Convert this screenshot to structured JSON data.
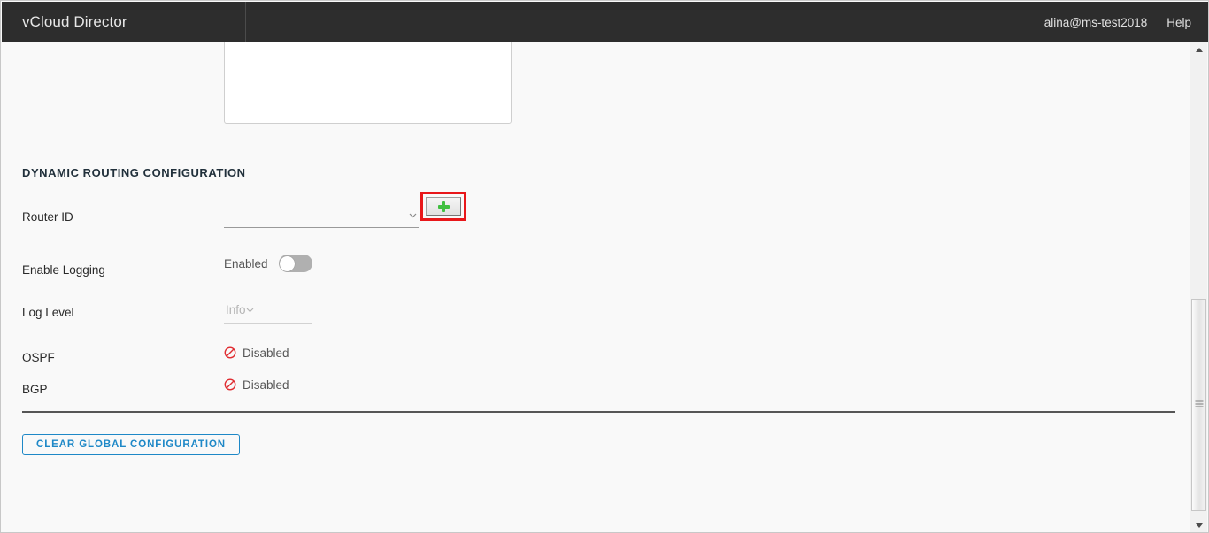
{
  "header": {
    "brand": "vCloud Director",
    "user": "alina@ms-test2018",
    "help": "Help"
  },
  "main": {
    "section_title": "DYNAMIC ROUTING CONFIGURATION",
    "rows": {
      "router_id": {
        "label": "Router ID",
        "value": "",
        "placeholder": "",
        "add_button_tooltip": "+"
      },
      "enable_logging": {
        "label": "Enable Logging",
        "state_text": "Enabled",
        "toggled": "false"
      },
      "log_level": {
        "label": "Log Level",
        "value": "Info",
        "disabled": "true"
      },
      "ospf": {
        "label": "OSPF",
        "status": "Disabled"
      },
      "bgp": {
        "label": "BGP",
        "status": "Disabled"
      }
    },
    "clear_button_label": "CLEAR GLOBAL CONFIGURATION"
  },
  "colors": {
    "header_bg": "#2d2d2d",
    "page_bg": "#f9f9f9",
    "accent_link": "#1e88c7",
    "highlight_red": "#e8171a",
    "status_red": "#e02b30",
    "plus_green": "#3fbf3f"
  }
}
